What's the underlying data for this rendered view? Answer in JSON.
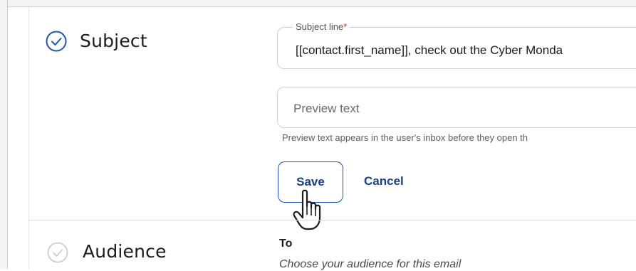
{
  "sections": {
    "subject": {
      "title": "Subject",
      "status": "complete",
      "subject_line": {
        "label": "Subject line",
        "required_marker": "*",
        "value": "[[contact.first_name]], check out the Cyber Monda"
      },
      "preview_text": {
        "placeholder": "Preview text",
        "helper": "Preview text appears in the user's inbox before they open th"
      },
      "actions": {
        "save_label": "Save",
        "cancel_label": "Cancel"
      }
    },
    "audience": {
      "title": "Audience",
      "status": "incomplete",
      "to_label": "To",
      "to_help": "Choose your audience for this email"
    }
  },
  "colors": {
    "accent": "#1f55b5",
    "check_complete": "#1f55b5",
    "check_incomplete": "#c8c8c8",
    "required": "#d42a2a"
  }
}
